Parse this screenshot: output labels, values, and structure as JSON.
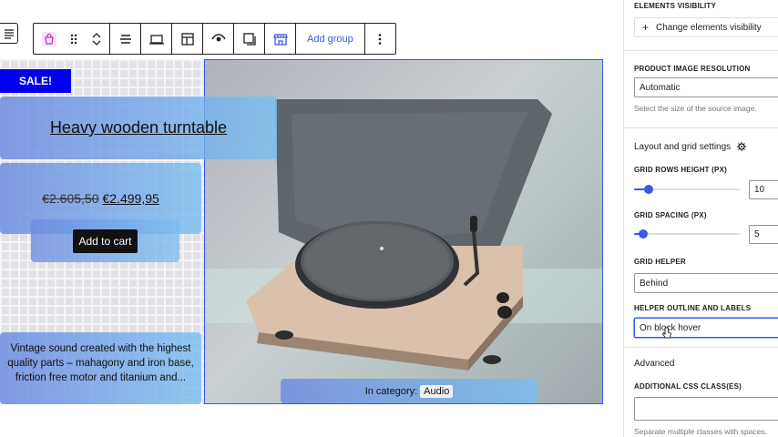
{
  "toolbar": {
    "add_group_label": "Add group"
  },
  "product": {
    "sale_badge": "SALE!",
    "title": "Heavy wooden turntable",
    "price_old": "€2.605,50",
    "price_new": "€2.499,95",
    "add_to_cart": "Add to cart",
    "description": "Vintage sound created with the highest quality parts – mahagony and iron base, friction free motor and titanium and...",
    "category_label": "In category:",
    "category_value": "Audio"
  },
  "sidebar": {
    "elements_visibility_label": "ELEMENTS VISIBILITY",
    "change_visibility_button": "Change elements visibility",
    "image_resolution_label": "PRODUCT IMAGE RESOLUTION",
    "image_resolution_value": "Automatic",
    "image_resolution_help": "Select the size of the source image.",
    "layout_heading": "Layout and grid settings",
    "grid_rows_height_label": "GRID ROWS HEIGHT (PX)",
    "grid_rows_height_value": "10",
    "grid_rows_height_fraction": 0.1,
    "grid_spacing_label": "GRID SPACING (PX)",
    "grid_spacing_value": "5",
    "grid_spacing_fraction": 0.05,
    "grid_helper_label": "GRID HELPER",
    "grid_helper_value": "Behind",
    "helper_outline_label": "HELPER OUTLINE AND LABELS",
    "helper_outline_value": "On block hover",
    "advanced_heading": "Advanced",
    "css_class_label": "ADDITIONAL CSS CLASS(ES)",
    "css_class_value": "",
    "css_class_help": "Separate multiple classes with spaces."
  },
  "colors": {
    "accent": "#3858e9",
    "sale_badge": "#0000ee",
    "tile_gradient_start": "#6e8ce1",
    "tile_gradient_end": "#78bef0"
  }
}
